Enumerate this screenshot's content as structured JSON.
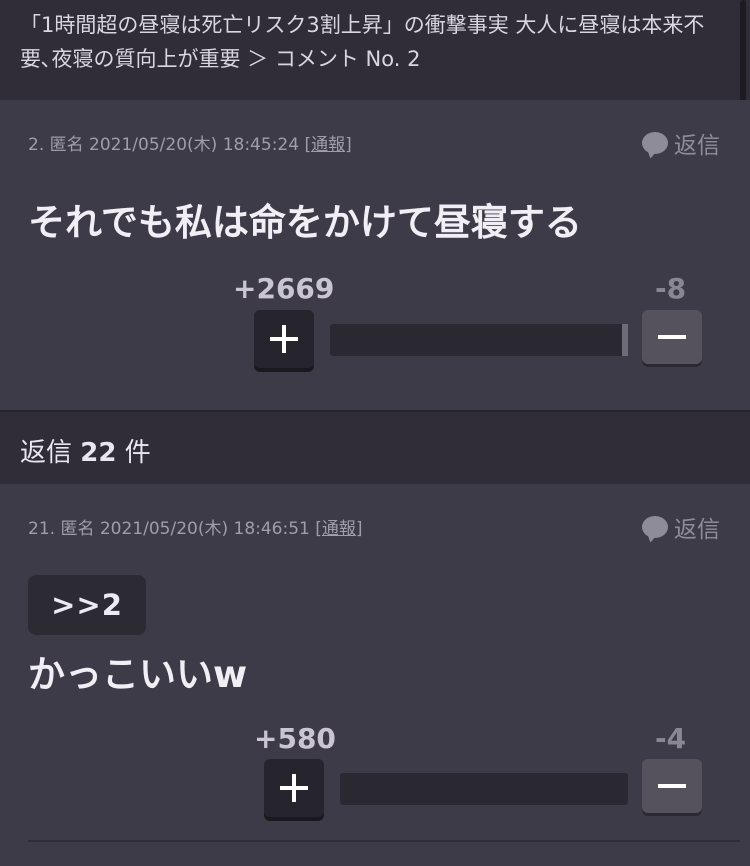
{
  "header": {
    "title": "「1時間超の昼寝は死亡リスク3割上昇」の衝撃事実 大人に昼寝は本来不要､夜寝の質向上が重要 ＞ コメント No. 2"
  },
  "main_comment": {
    "number": "2.",
    "author": "匿名",
    "datetime": "2021/05/20(木) 18:45:24",
    "report_label": "[通報]",
    "reply_label": "返信",
    "body": "それでも私は命をかけて昼寝する",
    "plus_count": "+2669",
    "minus_count": "-8",
    "approval_ratio": 0.997
  },
  "replies": {
    "prefix": "返信",
    "count": "22",
    "suffix": "件"
  },
  "reply_comment": {
    "number": "21.",
    "author": "匿名",
    "datetime": "2021/05/20(木) 18:46:51",
    "report_label": "[通報]",
    "reply_label": "返信",
    "quote": ">>2",
    "body": "かっこいいw",
    "plus_count": "+580",
    "minus_count": "-4",
    "approval_ratio": 0.993
  },
  "colors": {
    "background": "#3e3b48",
    "header_bg": "#302d38",
    "plus_button": "#26242c",
    "minus_button": "#55525e"
  },
  "icons": [
    "speech-bubble-icon",
    "plus-icon",
    "minus-icon"
  ]
}
